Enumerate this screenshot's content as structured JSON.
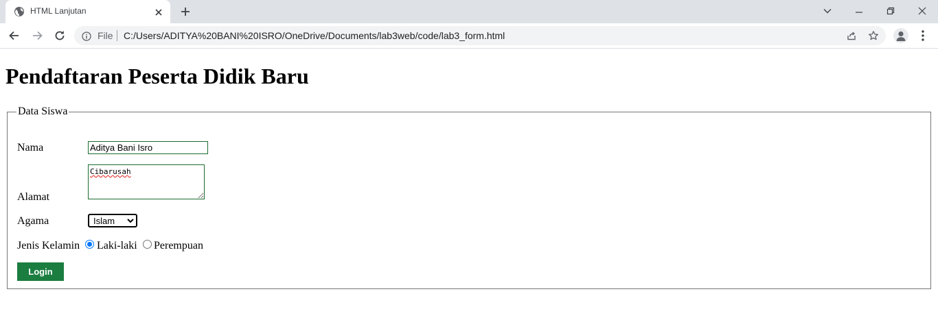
{
  "browser": {
    "tab_title": "HTML Lanjutan",
    "address_scheme": "File",
    "address_url": "C:/Users/ADITYA%20BANI%20ISRO/OneDrive/Documents/lab3web/code/lab3_form.html"
  },
  "page": {
    "heading": "Pendaftaran Peserta Didik Baru",
    "fieldset_legend": "Data Siswa",
    "form": {
      "nama_label": "Nama",
      "nama_value": "Aditya Bani Isro",
      "alamat_label": "Alamat",
      "alamat_value": "Cibarusah",
      "agama_label": "Agama",
      "agama_selected": "Islam",
      "jenis_kelamin_label": "Jenis Kelamin",
      "gender_options": [
        "Laki-laki",
        "Perempuan"
      ],
      "gender_selected": "Laki-laki",
      "submit_label": "Login"
    }
  },
  "colors": {
    "tabstrip_bg": "#dee1e6",
    "button_green": "#1b7d40",
    "input_border_green": "#1b6b2e",
    "radio_accent": "#0075ff"
  },
  "icons": [
    "globe-icon",
    "close-icon",
    "plus-icon",
    "chevron-down-icon",
    "minimize-icon",
    "restore-icon",
    "window-close-icon",
    "back-arrow-icon",
    "forward-arrow-icon",
    "reload-icon",
    "info-icon",
    "share-icon",
    "star-icon",
    "profile-icon",
    "more-vert-icon"
  ]
}
